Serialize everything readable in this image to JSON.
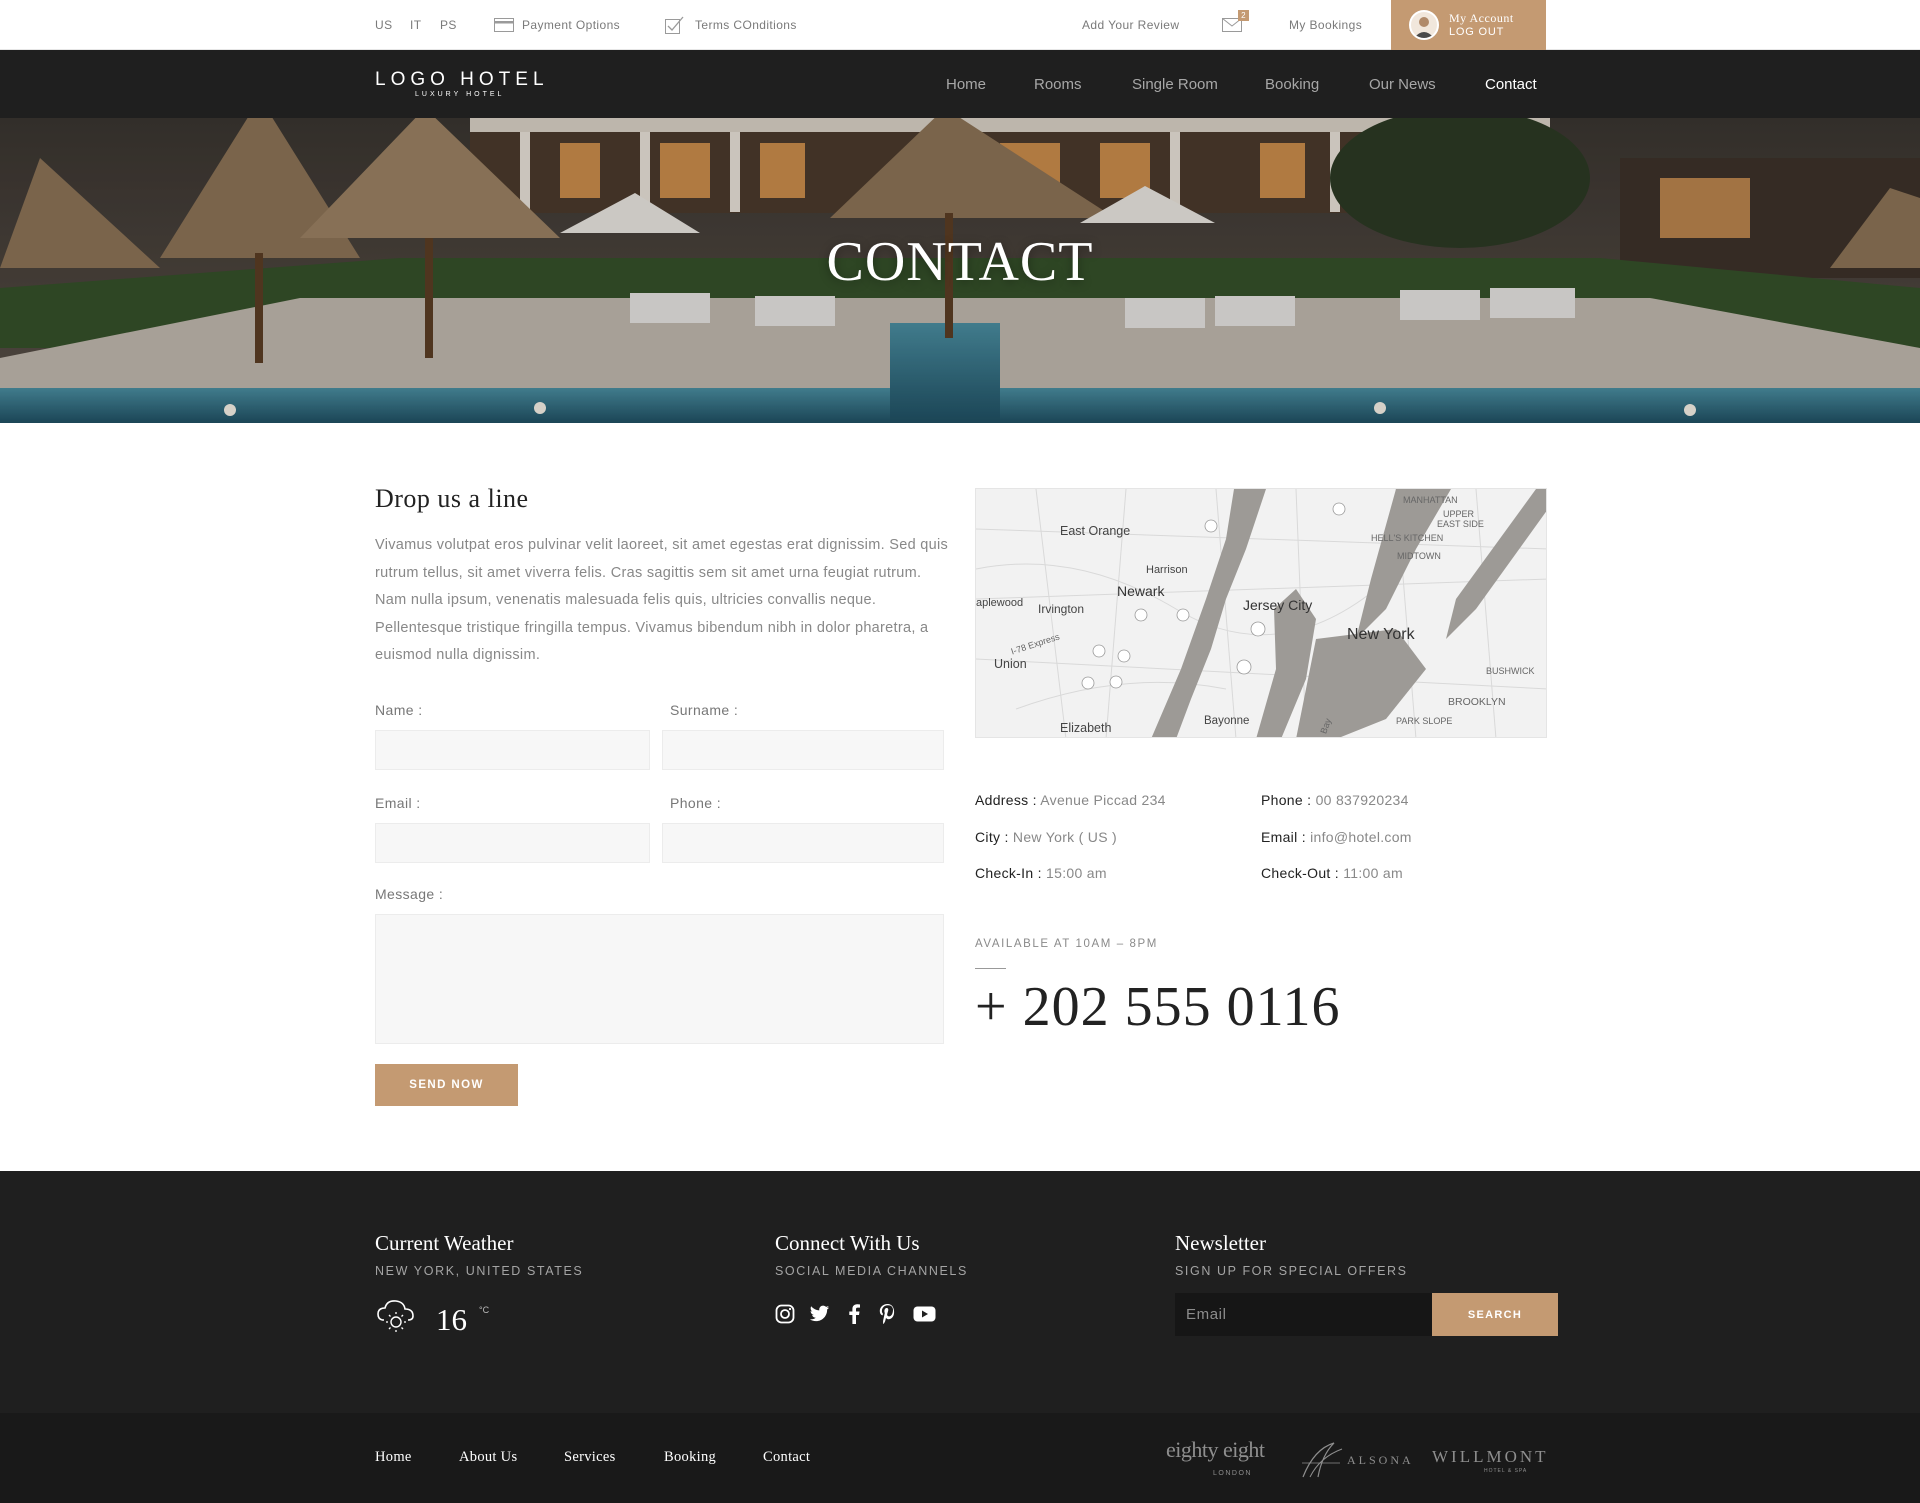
{
  "topbar": {
    "languages": [
      "US",
      "IT",
      "PS"
    ],
    "payment_options": "Payment Options",
    "terms": "Terms COnditions",
    "add_review": "Add Your Review",
    "mail_badge": "2",
    "my_bookings": "My Bookings",
    "account_label": "My Account",
    "logout_label": "LOG OUT"
  },
  "logo": {
    "main": "LOGO HOTEL",
    "sub": "LUXURY HOTEL"
  },
  "nav": [
    "Home",
    "Rooms",
    "Single Room",
    "Booking",
    "Our News",
    "Contact"
  ],
  "nav_active": "Contact",
  "hero": {
    "title": "CONTACT"
  },
  "contact_form": {
    "heading": "Drop us a line",
    "intro": "Vivamus volutpat eros pulvinar velit laoreet, sit amet egestas erat dignissim. Sed quis rutrum tellus, sit amet viverra felis. Cras sagittis sem sit amet urna feugiat rutrum. Nam nulla ipsum, venenatis malesuada felis quis, ultricies convallis neque. Pellentesque tristique fringilla tempus. Vivamus bibendum nibh in dolor pharetra, a euismod nulla dignissim.",
    "name_label": "Name :",
    "surname_label": "Surname :",
    "email_label": "Email :",
    "phone_label": "Phone :",
    "message_label": "Message :",
    "send_label": "SEND NOW"
  },
  "map": {
    "labels": [
      "East Orange",
      "Harrison",
      "Newark",
      "Irvington",
      "Jersey City",
      "New York",
      "Union",
      "Elizabeth",
      "Bayonne",
      "MANHATTAN",
      "UPPER",
      "EAST SIDE",
      "HELL'S KITCHEN",
      "MIDTOWN",
      "BUSHWICK",
      "BROOKLYN",
      "PARK SLOPE",
      "aplewood",
      "I-78 Express",
      "Bay"
    ]
  },
  "hotel_info": {
    "address_label": "Address :",
    "address": "Avenue Piccad 234",
    "phone_label": "Phone :",
    "phone": "00 837920234",
    "city_label": "City :",
    "city": "New York ( US )",
    "email_label": "Email :",
    "email": "info@hotel.com",
    "checkin_label": "Check-In :",
    "checkin": "15:00 am",
    "checkout_label": "Check-Out :",
    "checkout": "11:00 am",
    "available": "AVAILABLE AT 10AM – 8PM",
    "big_phone": "+ 202 555 0116"
  },
  "footer": {
    "weather_title": "Current Weather",
    "weather_location": "NEW YORK, UNITED STATES",
    "temperature": "16",
    "temp_unit": "°C",
    "connect_title": "Connect With Us",
    "connect_sub": "SOCIAL MEDIA CHANNELS",
    "social_icons": [
      "instagram-icon",
      "twitter-icon",
      "facebook-icon",
      "pinterest-icon",
      "youtube-icon"
    ],
    "newsletter_title": "Newsletter",
    "newsletter_sub": "SIGN UP FOR SPECIAL OFFERS",
    "newsletter_placeholder": "Email",
    "newsletter_button": "SEARCH"
  },
  "bottom_nav": [
    "Home",
    "About Us",
    "Services",
    "Booking",
    "Contact"
  ],
  "partners": {
    "eighty": "eighty eight",
    "eighty_sub": "LONDON",
    "alsona": "ALSONA",
    "willmont": "WILLMONT",
    "willmont_sub": "HOTEL & SPA"
  },
  "colors": {
    "accent": "#c49a72",
    "dark": "#1f1f1f",
    "darker": "#191919"
  }
}
